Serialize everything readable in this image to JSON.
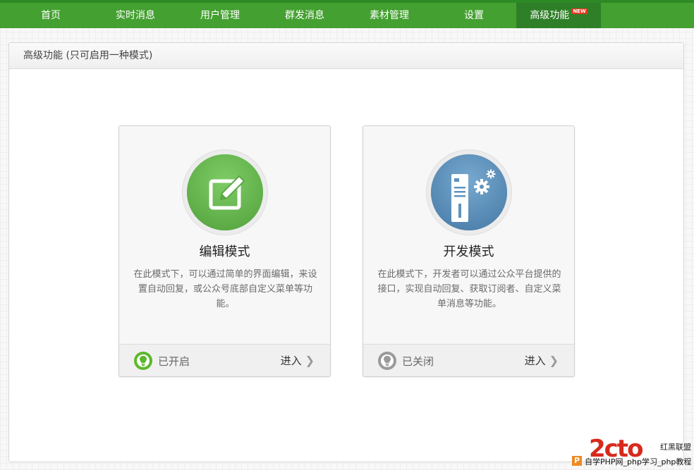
{
  "nav": {
    "items": [
      {
        "label": "首页"
      },
      {
        "label": "实时消息"
      },
      {
        "label": "用户管理"
      },
      {
        "label": "群发消息"
      },
      {
        "label": "素材管理"
      },
      {
        "label": "设置"
      },
      {
        "label": "高级功能",
        "badge": "NEW",
        "active": true
      }
    ],
    "color": "#44a030",
    "active_color": "#2f7f28"
  },
  "panel": {
    "title": "高级功能 (只可启用一种模式)"
  },
  "cards": [
    {
      "title": "编辑模式",
      "description": "在此模式下，可以通过简单的界面编辑，来设置自动回复，或公众号底部自定义菜单等功能。",
      "status": "已开启",
      "status_icon": "lightbulb-on-icon",
      "status_color": "#5cb82a",
      "enter_label": "进入",
      "icon": "edit-icon",
      "icon_color": "#6abd52"
    },
    {
      "title": "开发模式",
      "description": "在此模式下，开发者可以通过公众平台提供的接口，实现自动回复、获取订阅者、自定义菜单消息等功能。",
      "status": "已关闭",
      "status_icon": "lightbulb-off-icon",
      "status_color": "#9a9a9a",
      "enter_label": "进入",
      "icon": "server-gear-icon",
      "icon_color": "#5f93bd"
    }
  ],
  "watermark": {
    "logo_text": "2cto",
    "slogan": "红黑联盟",
    "box": "P",
    "site_text": "自学PHP网_php学习_php教程"
  }
}
